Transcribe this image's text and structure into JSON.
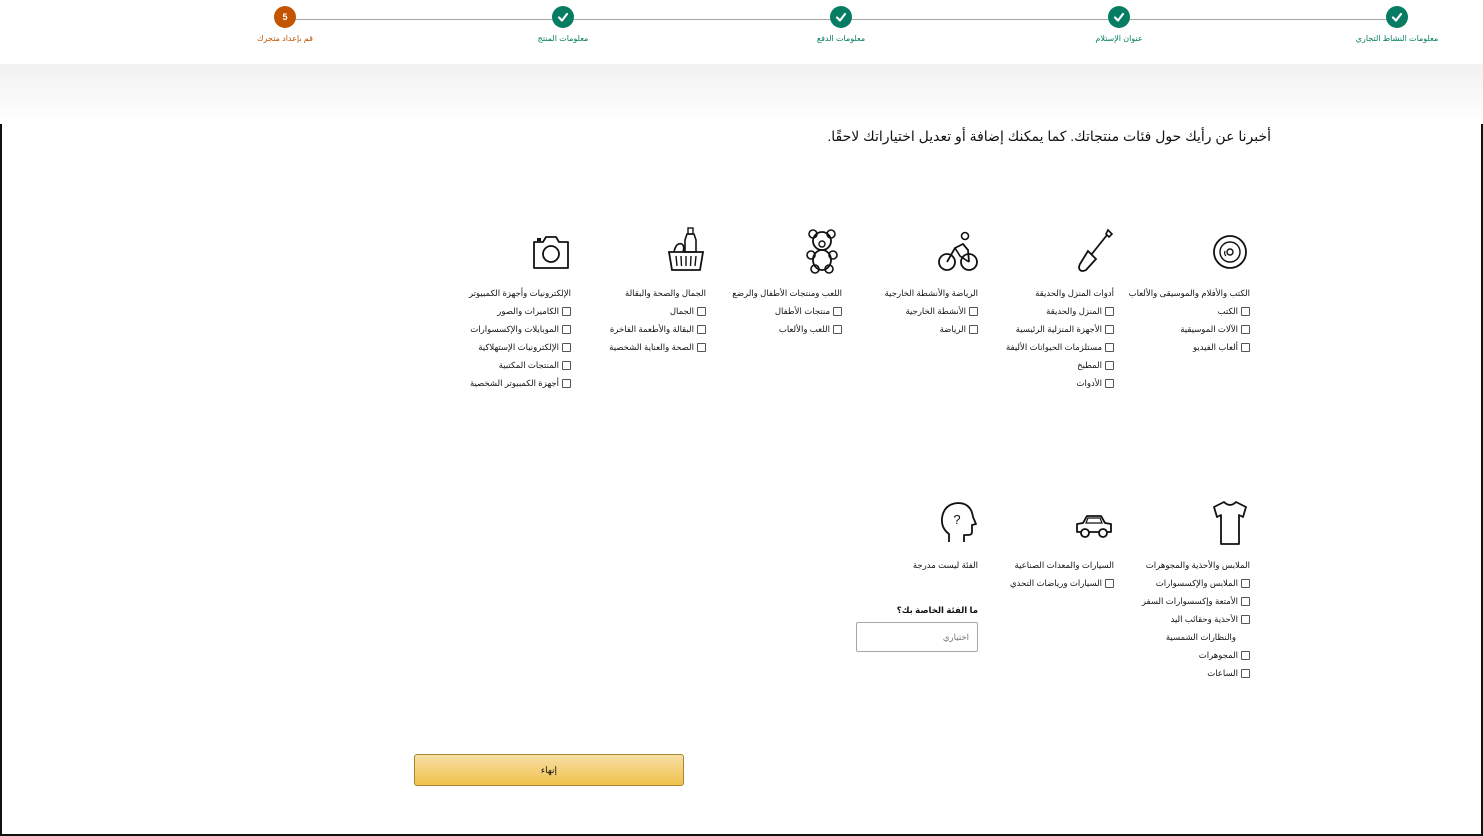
{
  "stepper": {
    "steps": [
      {
        "label": "معلومات النشاط التجاري",
        "state": "done"
      },
      {
        "label": "عنوان الإستلام",
        "state": "done"
      },
      {
        "label": "معلومات الدفع",
        "state": "done"
      },
      {
        "label": "معلومات المنتج",
        "state": "done"
      },
      {
        "label": "قم بإعداد متجرك",
        "state": "current",
        "number": "5"
      }
    ]
  },
  "intro": "أخبرنا عن رأيك حول فئات منتجاتك. كما يمكنك إضافة أو تعديل اختياراتك لاحقًا.",
  "categories": [
    {
      "icon": "disc-icon",
      "title": "الكتب والأفلام والموسيقى والألعاب",
      "options": [
        "الكتب",
        "الآلات الموسيقية",
        "ألعاب الفيديو"
      ]
    },
    {
      "icon": "shovel-icon",
      "title": "أدوات المنزل والحديقة",
      "options": [
        "المنزل والحديقة",
        "الأجهزة المنزلية الرئيسية",
        "مستلزمات الحيوانات الأليفة",
        "المطبخ",
        "الأدوات"
      ]
    },
    {
      "icon": "bicycle-icon",
      "title": "الرياضة والأنشطة الخارجية",
      "options": [
        "الأنشطة الخارجية",
        "الرياضة"
      ]
    },
    {
      "icon": "teddy-bear-icon",
      "title": "اللعب ومنتجات الأطفال والرضع",
      "options": [
        "منتجات الأطفال",
        "اللعب والألعاب"
      ]
    },
    {
      "icon": "grocery-basket-icon",
      "title": "الجمال والصحة والبقالة",
      "options": [
        "الجمال",
        "البقالة والأطعمة الفاخرة",
        "الصحة والعناية الشخصية"
      ]
    },
    {
      "icon": "camera-icon",
      "title": "الإلكترونيات وأجهزة الكمبيوتر",
      "options": [
        "الكاميرات والصور",
        "الموبايلات والإكسسوارات",
        "الإلكترونيات الإستهلاكية",
        "المنتجات المكتبية",
        "أجهزة الكمبيوتر الشخصية"
      ]
    },
    {
      "icon": "tshirt-icon",
      "title": "الملابس والأحذية والمجوهرات",
      "options": [
        "الملابس والإكسسوارات",
        "الأمتعة وإكسسوارات السفر",
        "الأحذية وحقائب اليد"
      ],
      "plain": "والنظارات الشمسية",
      "options2": [
        "المجوهرات",
        "الساعات"
      ]
    },
    {
      "icon": "car-icon",
      "title": "السيارات والمعدات الصناعية",
      "options": [
        "السيارات ورياضات التحدي"
      ]
    },
    {
      "icon": "question-head-icon",
      "title": "الفئة ليست مدرجة",
      "question": "ما الفئة الخاصة بك؟",
      "placeholder": "اختياري"
    }
  ],
  "finish_label": "إنهاء",
  "colors": {
    "done": "#067d62",
    "current": "#c45500",
    "button": "#f0c14b"
  }
}
